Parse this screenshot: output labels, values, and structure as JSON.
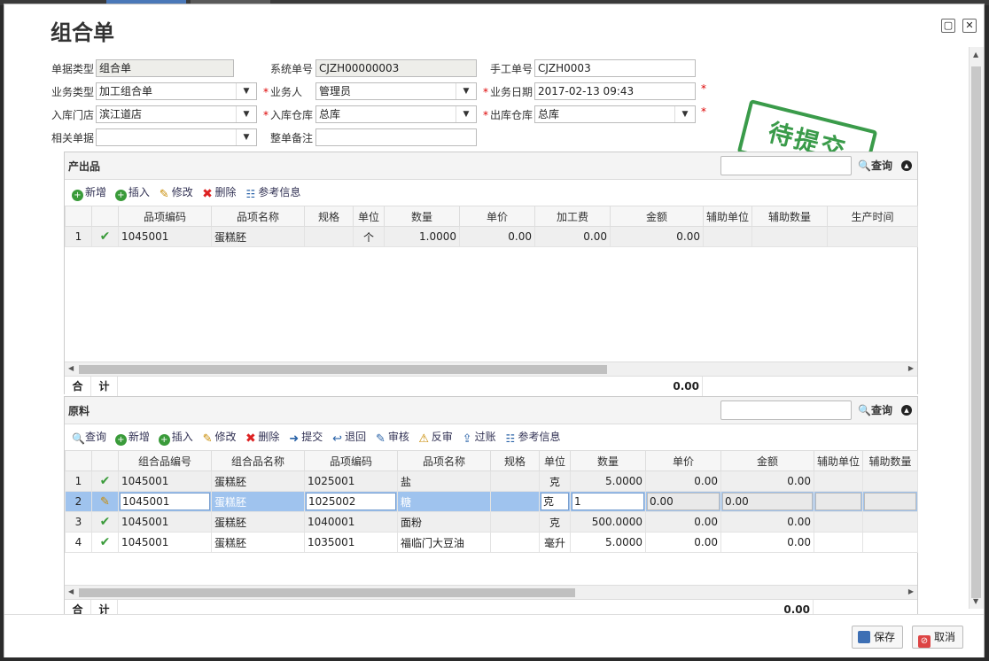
{
  "dialog": {
    "title": "组合单",
    "restore_icon": "▢",
    "close_icon": "✕"
  },
  "form": {
    "doc_type": {
      "label": "单据类型",
      "value": "组合单"
    },
    "system_no": {
      "label": "系统单号",
      "value": "CJZH00000003"
    },
    "manual_no": {
      "label": "手工单号",
      "value": "CJZH0003"
    },
    "biz_type": {
      "label": "业务类型",
      "value": "加工组合单"
    },
    "operator": {
      "label": "业务人",
      "value": "管理员"
    },
    "biz_date": {
      "label": "业务日期",
      "value": "2017-02-13 09:43"
    },
    "in_store": {
      "label": "入库门店",
      "value": "滨江道店"
    },
    "in_warehouse": {
      "label": "入库仓库",
      "value": "总库"
    },
    "out_warehouse": {
      "label": "出库仓库",
      "value": "总库"
    },
    "related_doc": {
      "label": "相关单据",
      "value": ""
    },
    "remark": {
      "label": "整单备注",
      "value": ""
    },
    "required_mark": "*",
    "stamp": "待提交"
  },
  "products": {
    "title": "产出品",
    "search_label": "查询",
    "toolbar": {
      "add": "新增",
      "insert": "插入",
      "edit": "修改",
      "delete": "删除",
      "ref": "参考信息"
    },
    "columns": [
      "品项编码",
      "品项名称",
      "规格",
      "单位",
      "数量",
      "单价",
      "加工费",
      "金额",
      "辅助单位",
      "辅助数量",
      "生产时间"
    ],
    "rows": [
      {
        "no": "1",
        "code": "1045001",
        "name": "蛋糕胚",
        "spec": "",
        "unit": "个",
        "qty": "1.0000",
        "price": "0.00",
        "fee": "0.00",
        "amount": "0.00"
      }
    ],
    "total_label_1": "合",
    "total_label_2": "计",
    "total_amount": "0.00"
  },
  "materials": {
    "title": "原料",
    "search_label": "查询",
    "toolbar": {
      "query": "查询",
      "add": "新增",
      "insert": "插入",
      "edit": "修改",
      "delete": "删除",
      "submit": "提交",
      "back": "退回",
      "audit": "审核",
      "unaudit": "反审",
      "post": "过账",
      "ref": "参考信息"
    },
    "columns": [
      "组合品编号",
      "组合品名称",
      "品项编码",
      "品项名称",
      "规格",
      "单位",
      "数量",
      "单价",
      "金额",
      "辅助单位",
      "辅助数量"
    ],
    "rows": [
      {
        "no": "1",
        "combo_code": "1045001",
        "combo_name": "蛋糕胚",
        "code": "1025001",
        "name": "盐",
        "spec": "",
        "unit": "克",
        "qty": "5.0000",
        "price": "0.00",
        "amount": "0.00"
      },
      {
        "no": "2",
        "combo_code": "1045001",
        "combo_name": "蛋糕胚",
        "code": "1025002",
        "name": "糖",
        "spec": "",
        "unit": "克",
        "qty": "1",
        "price": "0.00",
        "amount": "0.00"
      },
      {
        "no": "3",
        "combo_code": "1045001",
        "combo_name": "蛋糕胚",
        "code": "1040001",
        "name": "面粉",
        "spec": "",
        "unit": "克",
        "qty": "500.0000",
        "price": "0.00",
        "amount": "0.00"
      },
      {
        "no": "4",
        "combo_code": "1045001",
        "combo_name": "蛋糕胚",
        "code": "1035001",
        "name": "福临门大豆油",
        "spec": "",
        "unit": "毫升",
        "qty": "5.0000",
        "price": "0.00",
        "amount": "0.00"
      }
    ],
    "total_label_1": "合",
    "total_label_2": "计",
    "total_amount": "0.00"
  },
  "footer": {
    "save": "保存",
    "cancel": "取消"
  },
  "icons": {
    "check": "✔",
    "pencil": "✎",
    "dropdown": "▼",
    "collapse": "▲",
    "search": "🔍"
  }
}
